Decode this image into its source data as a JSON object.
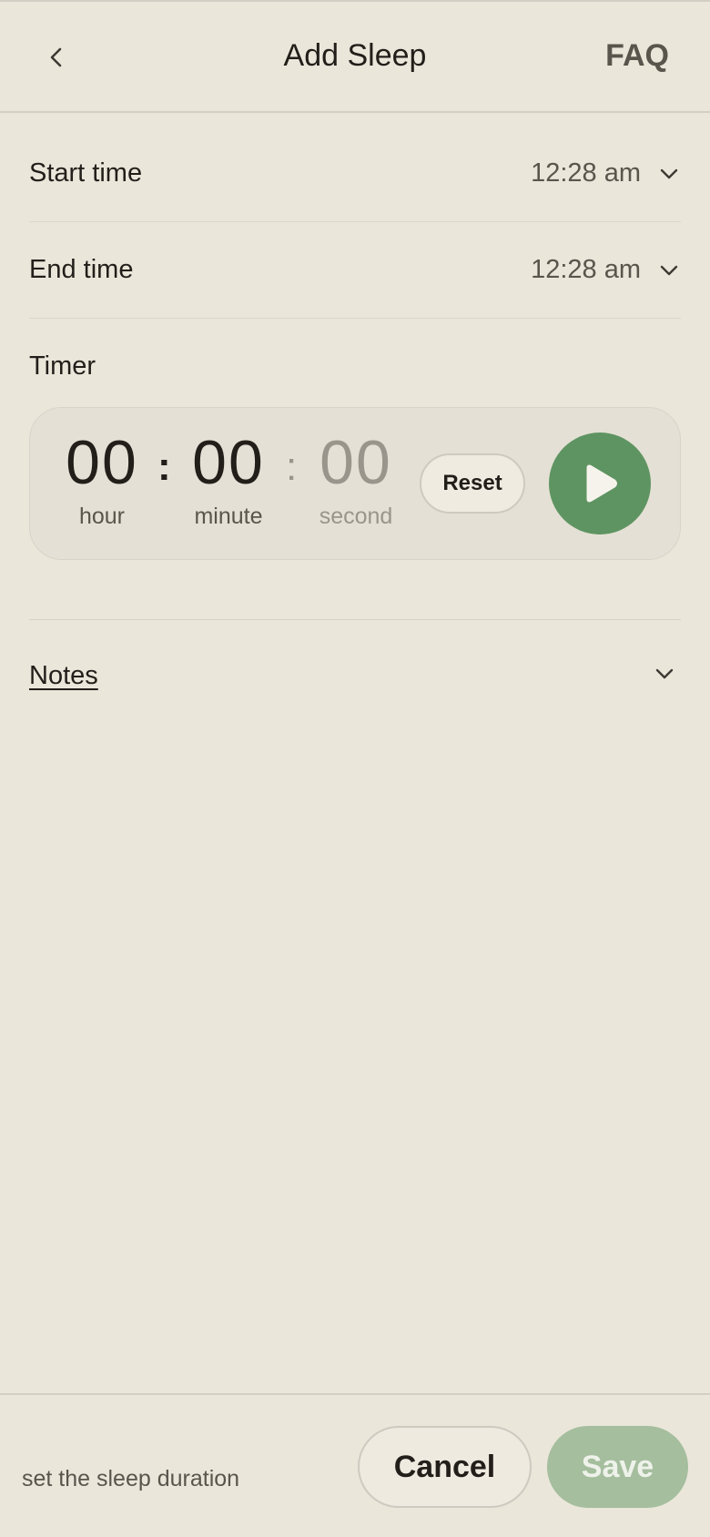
{
  "header": {
    "title": "Add Sleep",
    "faq_label": "FAQ",
    "back_icon": "chevron-left-icon"
  },
  "start_time": {
    "label": "Start time",
    "value": "12:28 am",
    "icon": "chevron-down-icon"
  },
  "end_time": {
    "label": "End time",
    "value": "12:28 am",
    "icon": "chevron-down-icon"
  },
  "timer": {
    "label": "Timer",
    "hour": "00",
    "hour_label": "hour",
    "minute": "00",
    "minute_label": "minute",
    "second": "00",
    "second_label": "second",
    "separator": ":",
    "reset_label": "Reset",
    "play_icon": "play-icon"
  },
  "notes": {
    "label": "Notes",
    "icon": "chevron-down-icon"
  },
  "footer": {
    "hint": "set the sleep duration",
    "cancel_label": "Cancel",
    "save_label": "Save"
  },
  "colors": {
    "background": "#EAE6DA",
    "accent_green": "#5E9461",
    "save_disabled": "#A5BE9E",
    "text_primary": "#221F1A",
    "text_secondary": "#5A554C"
  }
}
